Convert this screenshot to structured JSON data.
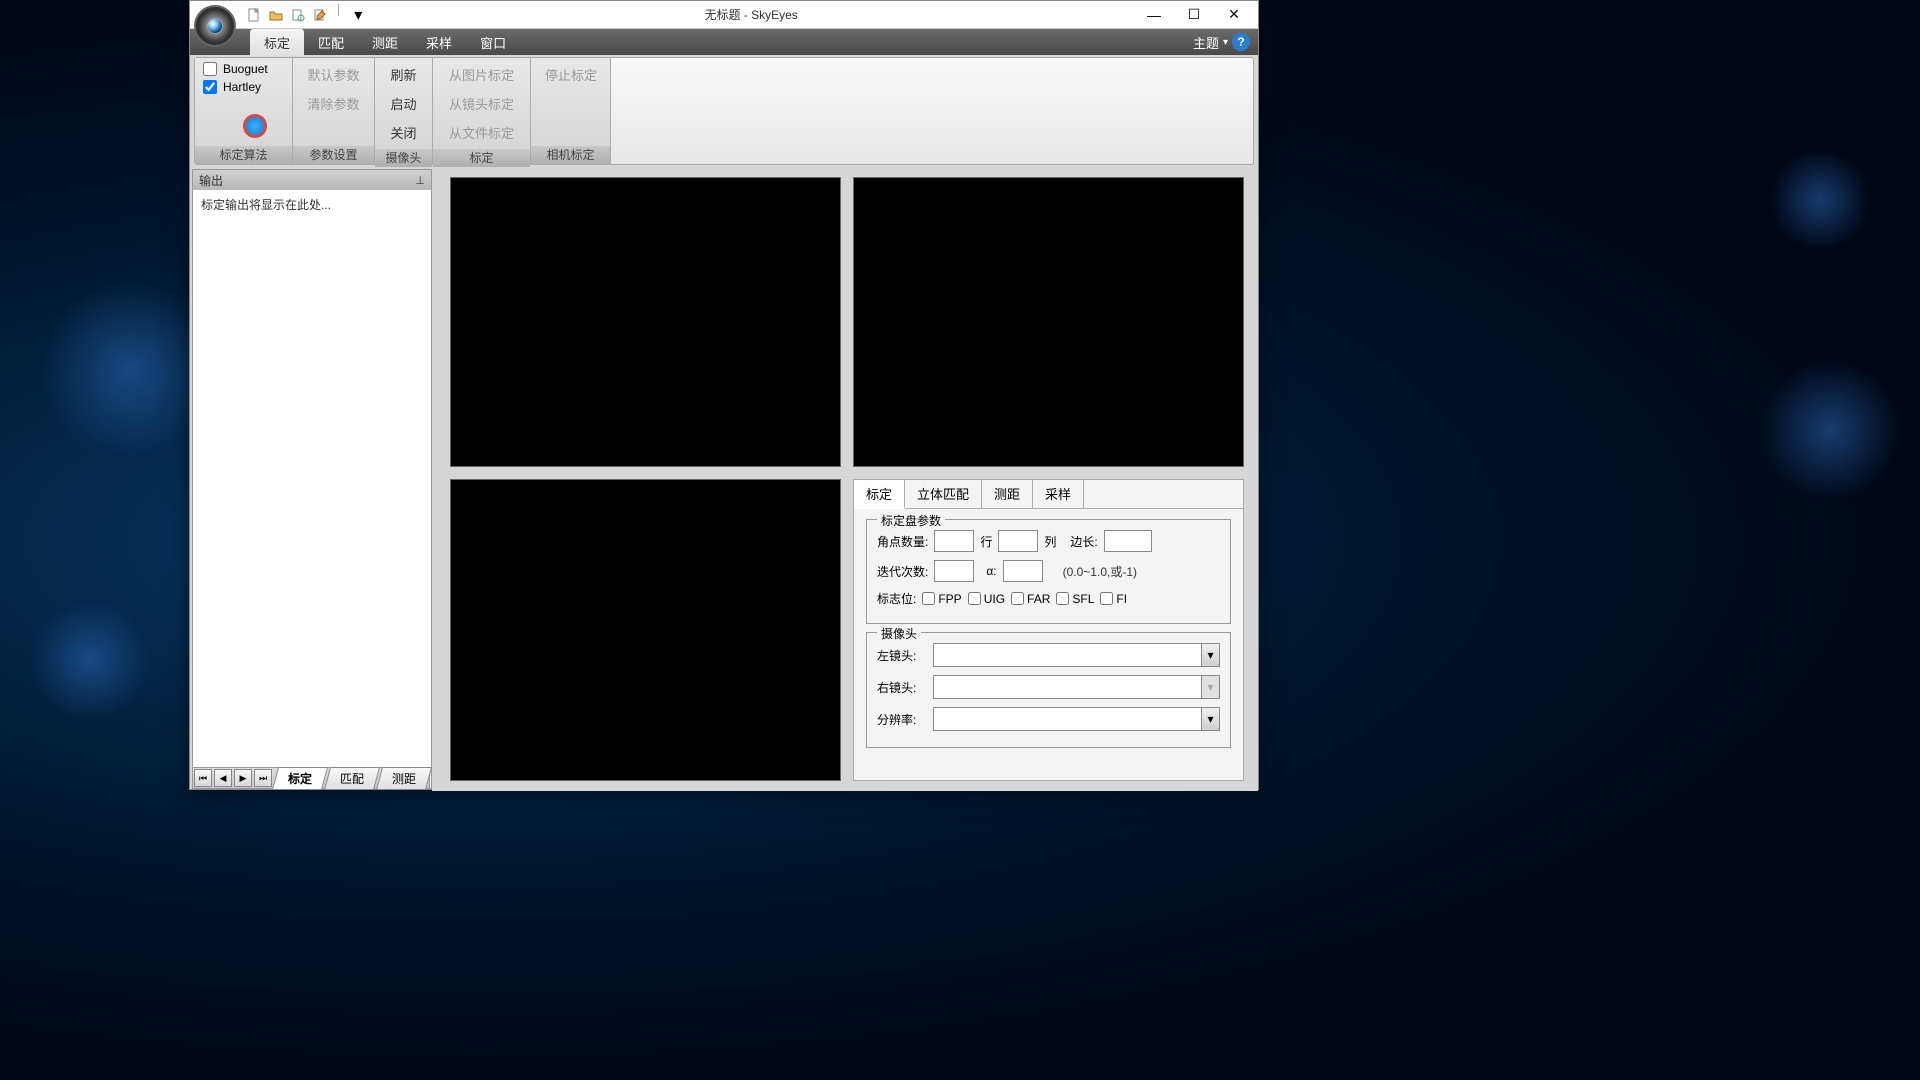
{
  "window": {
    "title": "无标题 - SkyEyes"
  },
  "menu": {
    "items": [
      "标定",
      "匹配",
      "测距",
      "采样",
      "窗口"
    ],
    "theme_label": "主题"
  },
  "ribbon": {
    "group_algo": {
      "label": "标定算法",
      "chk_buoguet": "Buoguet",
      "chk_hartley": "Hartley"
    },
    "group_params": {
      "label": "参数设置",
      "default_params": "默认参数",
      "clear_params": "清除参数"
    },
    "group_camera": {
      "label": "摄像头",
      "refresh": "刷新",
      "start": "启动",
      "close": "关闭"
    },
    "group_calib": {
      "label": "标定",
      "from_image": "从图片标定",
      "from_lens": "从镜头标定",
      "from_file": "从文件标定"
    },
    "group_camcalib": {
      "label": "相机标定",
      "stop": "停止标定"
    }
  },
  "sidebar": {
    "title": "输出",
    "placeholder": "标定输出将显示在此处..."
  },
  "params": {
    "tabs": [
      "标定",
      "立体匹配",
      "测距",
      "采样"
    ],
    "group_board": {
      "legend": "标定盘参数",
      "corner_count": "角点数量:",
      "row": "行",
      "col": "列",
      "edge": "边长:",
      "iterations": "迭代次数:",
      "alpha": "α:",
      "alpha_hint": "(0.0~1.0,或-1)",
      "flags": "标志位:",
      "flag_items": [
        "FPP",
        "UIG",
        "FAR",
        "SFL",
        "FI"
      ]
    },
    "group_cam": {
      "legend": "摄像头",
      "left_lens": "左镜头:",
      "right_lens": "右镜头:",
      "resolution": "分辨率:"
    }
  },
  "bottom_tabs": [
    "标定",
    "匹配",
    "测距"
  ]
}
